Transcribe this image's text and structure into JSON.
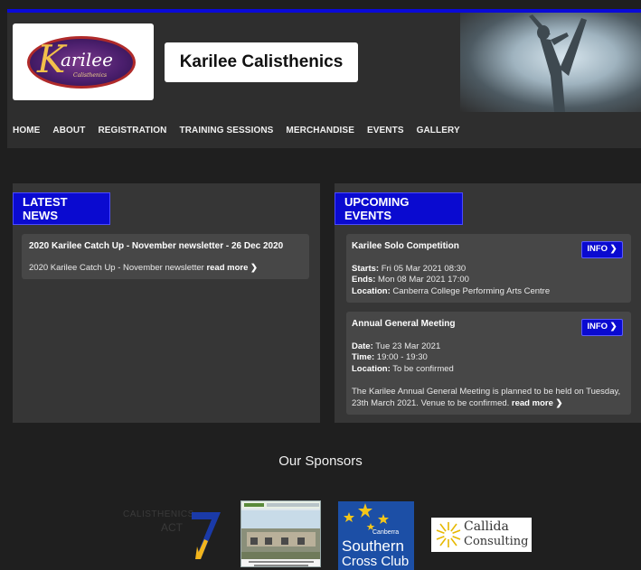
{
  "site": {
    "title": "Karilee Calisthenics",
    "logo_word": "arilee",
    "logo_initial": "K",
    "logo_sub": "Calisthenics"
  },
  "nav": [
    "HOME",
    "ABOUT",
    "REGISTRATION",
    "TRAINING SESSIONS",
    "MERCHANDISE",
    "EVENTS",
    "GALLERY"
  ],
  "news": {
    "heading": "LATEST NEWS",
    "item_title": "2020 Karilee Catch Up - November newsletter - 26 Dec 2020",
    "item_body": "2020 Karilee Catch Up - November newsletter",
    "read_more": "read more ❯"
  },
  "events": {
    "heading": "UPCOMING EVENTS",
    "info_label": "INFO ❯",
    "e1": {
      "title": "Karilee Solo Competition",
      "starts_label": "Starts:",
      "starts": " Fri 05 Mar 2021 08:30",
      "ends_label": "Ends:",
      "ends": " Mon 08 Mar 2021 17:00",
      "loc_label": "Location:",
      "loc": " Canberra College Performing Arts Centre"
    },
    "e2": {
      "title": "Annual General Meeting",
      "date_label": "Date:",
      "date": " Tue 23 Mar 2021",
      "time_label": "Time:",
      "time": " 19:00 - 19:30",
      "loc_label": "Location:",
      "loc": " To be confirmed",
      "desc": "The Karilee Annual General Meeting is planned to be held on Tuesday, 23th March 2021. Venue to be confirmed.",
      "read_more": "read more ❯"
    }
  },
  "sponsors": {
    "heading": "Our Sponsors",
    "act_line1": "CALISTHENICS",
    "act_line2": "ACT",
    "club_small": "Canberra",
    "club_line1": "Southern",
    "club_line2": "Cross Club",
    "callida_line1": "Callida",
    "callida_line2": "Consulting"
  },
  "colors": {
    "accent": "#0a0ad0",
    "panel": "#363636",
    "card": "#474747",
    "background": "#1f1f1f"
  }
}
